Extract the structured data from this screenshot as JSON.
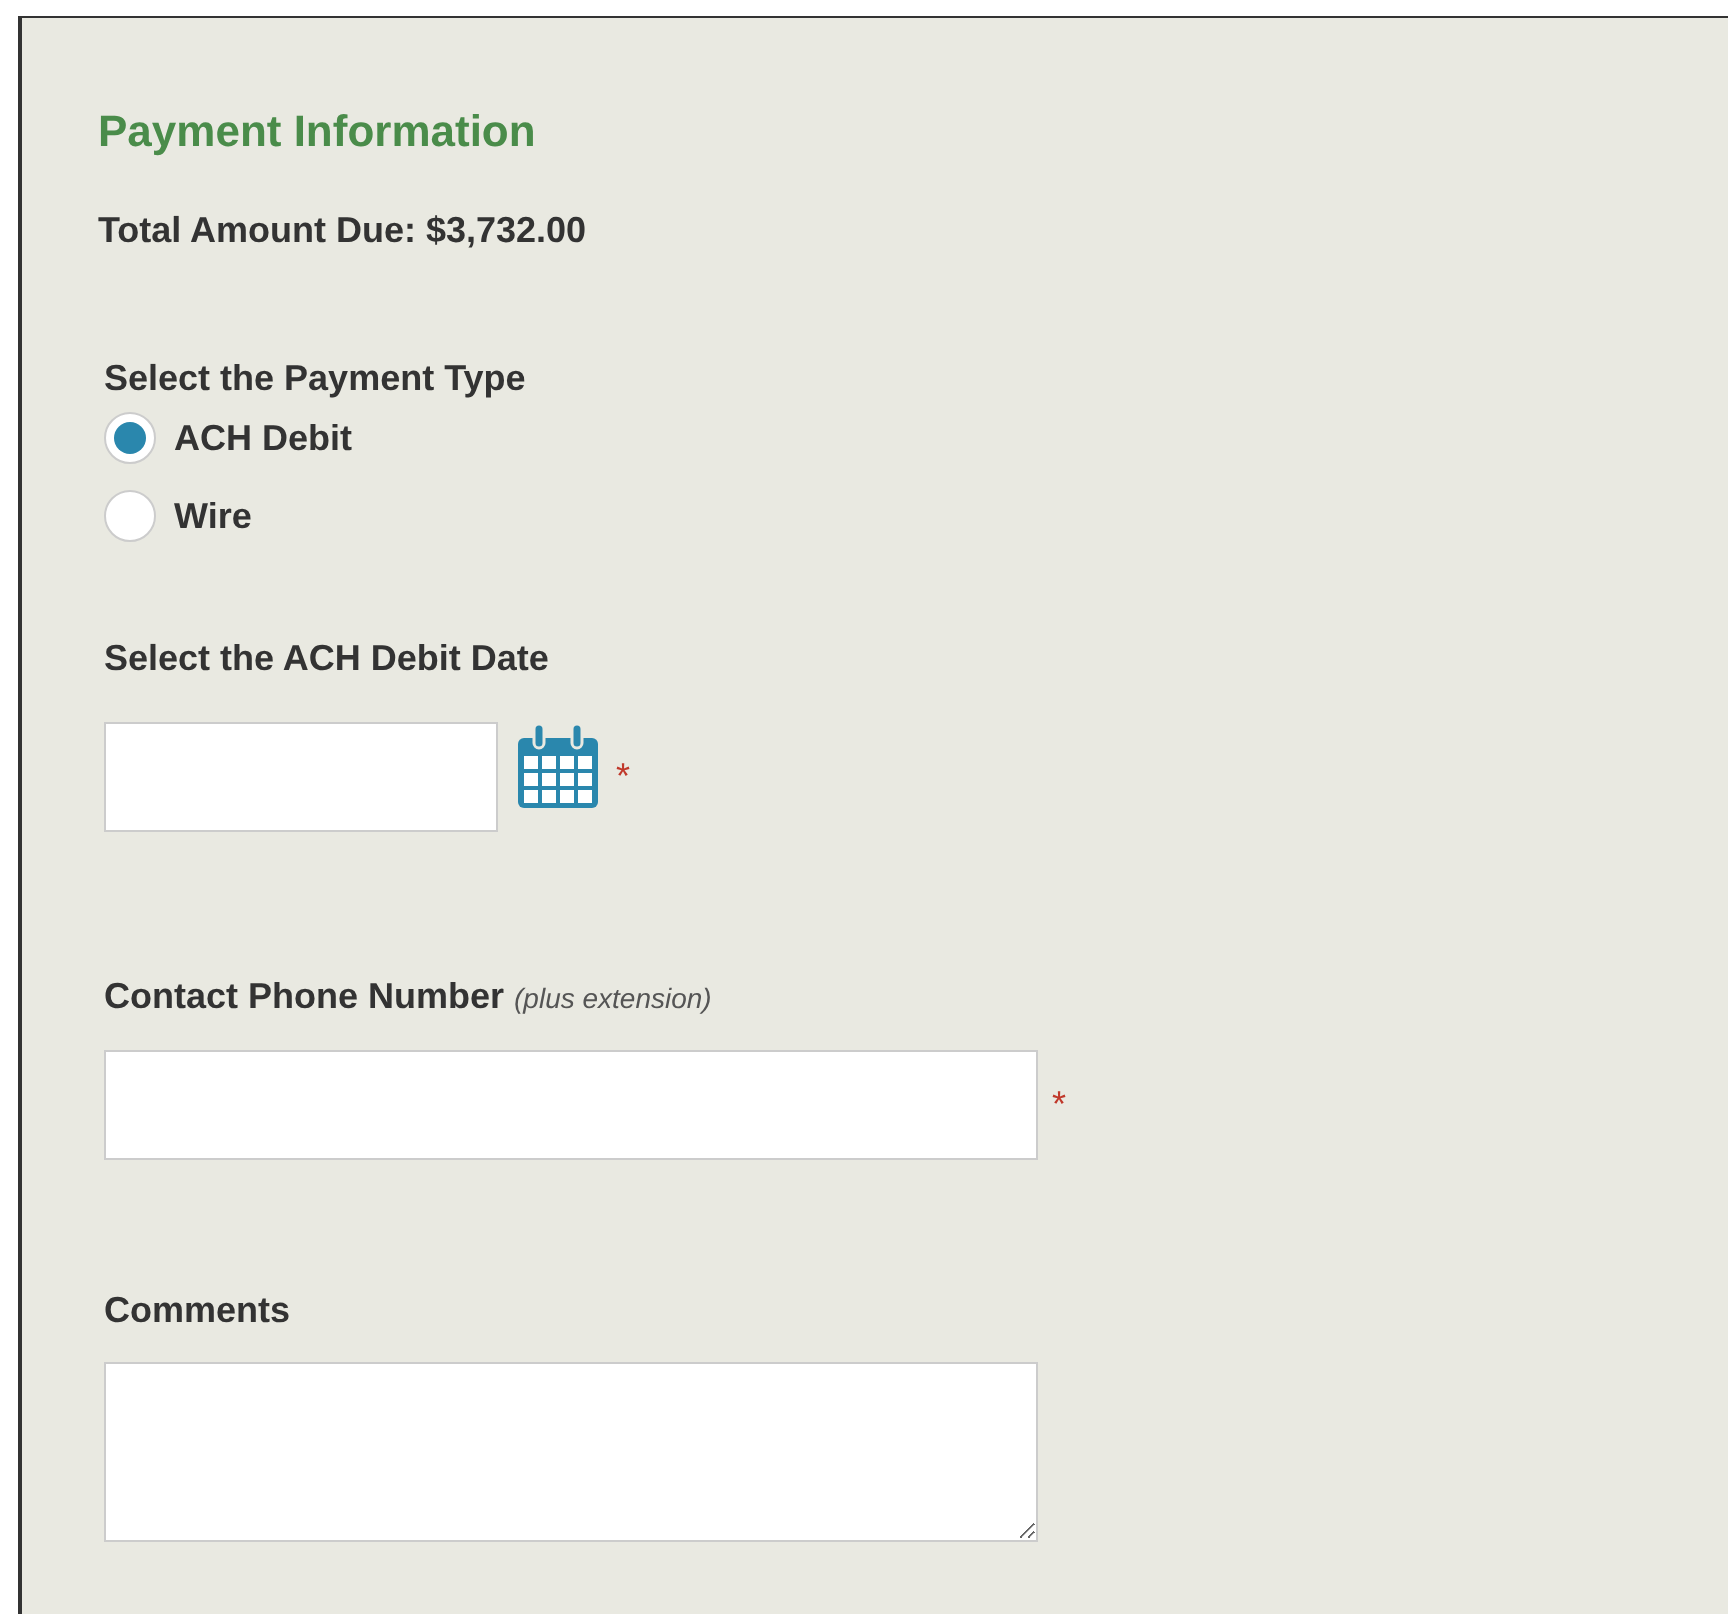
{
  "section_title": "Payment Information",
  "total": "Total Amount Due: $3,732.00",
  "payment_type": {
    "label": "Select the Payment Type",
    "options": [
      {
        "label": "ACH Debit",
        "selected": true
      },
      {
        "label": "Wire",
        "selected": false
      }
    ]
  },
  "debit_date": {
    "label": "Select the ACH Debit Date",
    "required_mark": "*"
  },
  "phone": {
    "label": "Contact Phone Number",
    "hint": "(plus extension)",
    "required_mark": "*"
  },
  "comments": {
    "label": "Comments"
  }
}
